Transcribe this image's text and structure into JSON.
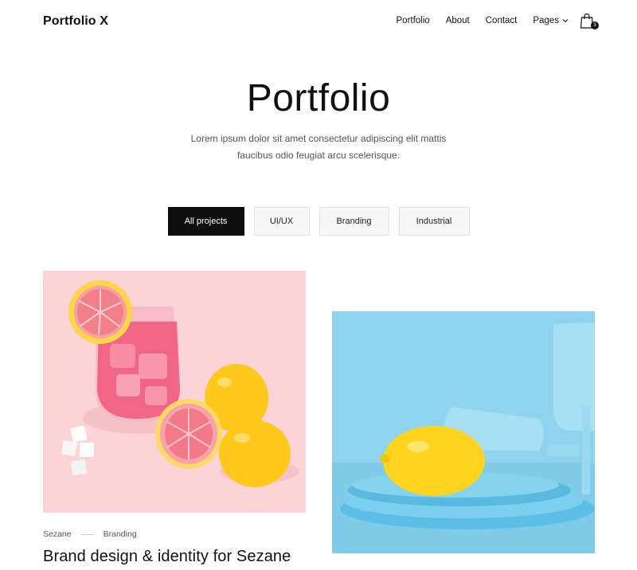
{
  "header": {
    "logo": "Portfolio X",
    "nav": [
      {
        "label": "Portfolio"
      },
      {
        "label": "About"
      },
      {
        "label": "Contact"
      },
      {
        "label": "Pages"
      }
    ],
    "cart_count": "3",
    "icons": [
      "chevron-down-icon",
      "shopping-bag-icon"
    ]
  },
  "hero": {
    "title": "Portfolio",
    "description_line1": "Lorem ipsum dolor sit amet consectetur adipiscing elit mattis",
    "description_line2": "faucibus odio feugiat arcu scelerisque."
  },
  "filters": [
    {
      "label": "All projects",
      "active": true
    },
    {
      "label": "UI/UX",
      "active": false
    },
    {
      "label": "Branding",
      "active": false
    },
    {
      "label": "Industrial",
      "active": false
    }
  ],
  "projects": [
    {
      "client": "Sezane",
      "category": "Branding",
      "title": "Brand design & identity for Sezane"
    }
  ],
  "colors": {
    "text": "#111111",
    "muted": "#555555",
    "active_filter_bg": "#0e0e0e",
    "filter_bg": "#f7f7f7",
    "card1_bg": "#fcd3d7",
    "card2_bg": "#8fd3ee"
  }
}
